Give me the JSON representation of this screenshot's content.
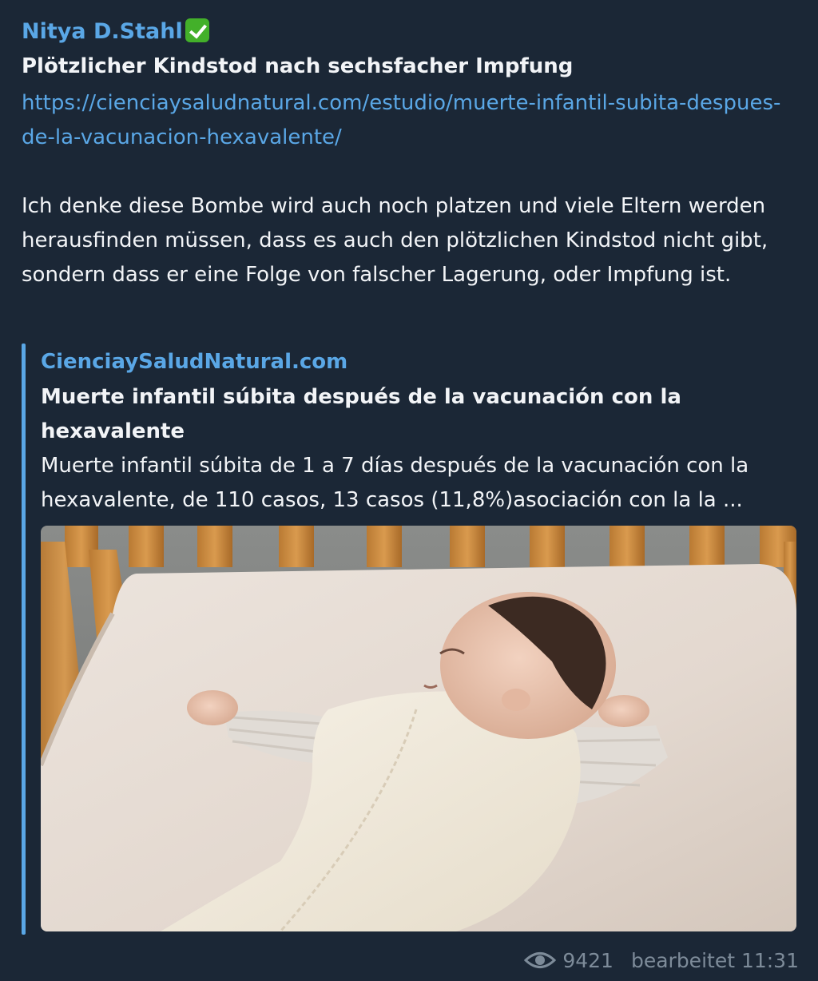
{
  "message": {
    "author": "Nitya D.Stahl",
    "author_badge_icon": "verified-checkmark-icon",
    "title": "Plötzlicher Kindstod nach sechsfacher Impfung",
    "link": "https://cienciaysaludnatural.com/estudio/muerte-infantil-subita-despues-de-la-vacunacion-hexavalente/",
    "body": "Ich denke diese Bombe wird auch noch platzen und viele Eltern werden herausfinden müssen, dass es auch den plötzlichen Kindstod nicht gibt, sondern dass er eine Folge von falscher Lagerung, oder Impfung ist."
  },
  "preview": {
    "site_name": "CienciaySaludNatural.com",
    "title": "Muerte infantil súbita después de la vacunación con la hexavalente",
    "description": "Muerte infantil súbita de 1 a 7 días después de la vacunación con la hexavalente, de 110 casos, 13 casos (11,8%)asociación con la la ...",
    "image_icon": "sleeping-baby-photo"
  },
  "footer": {
    "views_icon": "eye-icon",
    "views": "9421",
    "edited": "bearbeitet 11:31"
  },
  "colors": {
    "background": "#1b2736",
    "accent": "#5aa7e6",
    "text": "#f2f4f7",
    "muted": "#7d8b99",
    "badge": "#43b02a"
  }
}
